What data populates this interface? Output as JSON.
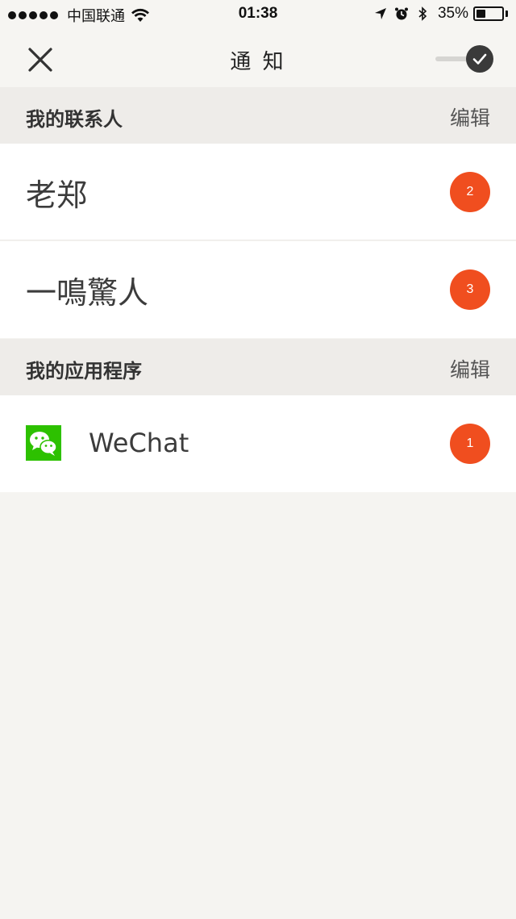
{
  "status_bar": {
    "carrier": "中国联通",
    "time": "01:38",
    "battery_percent": "35%",
    "battery_level": 0.35,
    "signal_dots": 5
  },
  "nav": {
    "title": "通 知",
    "toggle_on": true
  },
  "sections": {
    "contacts": {
      "title": "我的联系人",
      "edit_label": "编辑",
      "items": [
        {
          "name": "老郑",
          "badge": "2"
        },
        {
          "name": "一鳴驚人",
          "badge": "3"
        }
      ]
    },
    "apps": {
      "title": "我的应用程序",
      "edit_label": "编辑",
      "items": [
        {
          "name": "WeChat",
          "icon": "wechat-icon",
          "badge": "1"
        }
      ]
    }
  },
  "colors": {
    "badge": "#f04e1f",
    "background": "#f5f4f1",
    "section_header": "#eeece9",
    "wechat_green": "#2dc100"
  }
}
